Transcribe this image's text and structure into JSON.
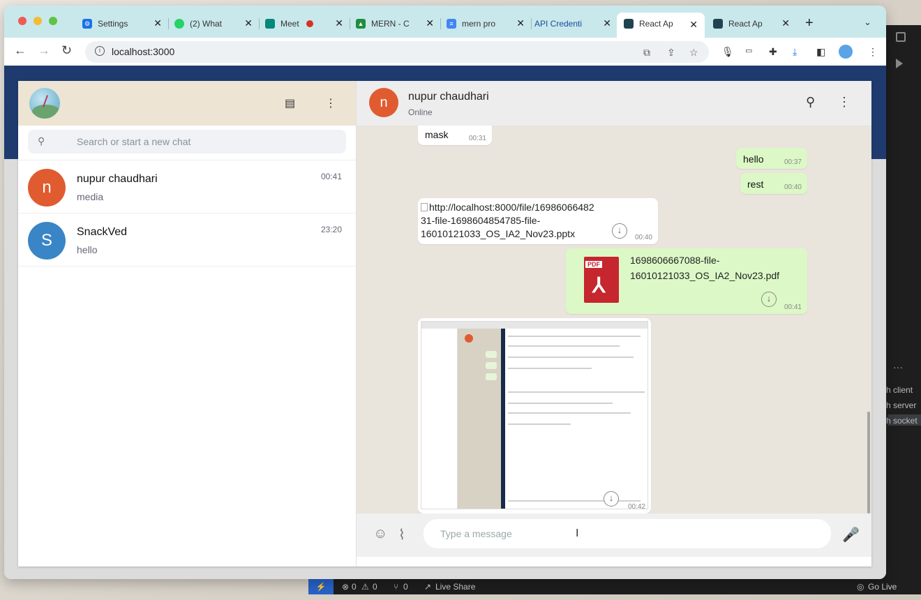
{
  "browser": {
    "tabs": [
      {
        "label": "Settings",
        "favicon": "gear-icon",
        "color": "#1a73e8"
      },
      {
        "label": "(2) What",
        "favicon": "whatsapp-icon",
        "color": "#25d366"
      },
      {
        "label": "Meet",
        "favicon": "meet-icon",
        "color": "#00897b"
      },
      {
        "label": "MERN - C",
        "favicon": "drive-icon",
        "color": "#1e8e3e"
      },
      {
        "label": "mern pro",
        "favicon": "docs-icon",
        "color": "#4285f4"
      },
      {
        "label": "API Credenti",
        "favicon": "api-icon",
        "color": "#5f86c5"
      },
      {
        "label": "React Ap",
        "favicon": "react-icon",
        "color": "#20444f"
      },
      {
        "label": "React Ap",
        "favicon": "react-icon",
        "color": "#20444f"
      }
    ],
    "active_tab_index": 6,
    "url": "localhost:3000"
  },
  "sidebar": {
    "search_placeholder": "Search or start a new chat",
    "chats": [
      {
        "initial": "n",
        "name": "nupur chaudhari",
        "preview": "media",
        "time": "00:41",
        "color": "#e05b30"
      },
      {
        "initial": "S",
        "name": "SnackVed",
        "preview": "hello",
        "time": "23:20",
        "color": "#3a85c6"
      }
    ]
  },
  "conversation": {
    "contact_initial": "n",
    "contact_name": "nupur chaudhari",
    "status": "Online",
    "messages": {
      "m1": {
        "text": "mask",
        "time": "00:31"
      },
      "m2": {
        "text": "hello",
        "time": "00:37"
      },
      "m3": {
        "text": "rest",
        "time": "00:40"
      },
      "m4": {
        "line1": "http://localhost:8000/file/16986066482",
        "line2": "31-file-1698604854785-file-",
        "line3": "16010121033_OS_IA2_Nov23.pptx",
        "time": "00:40"
      },
      "m5": {
        "line1": "1698606667088-file-",
        "line2": "16010121033_OS_IA2_Nov23.pdf",
        "time": "00:41",
        "badge": "PDF"
      },
      "m6": {
        "time": "00:42"
      }
    },
    "composer_placeholder": "Type a message"
  },
  "statusbar": {
    "errors": "0",
    "warnings": "0",
    "ports": "0",
    "live_share": "Live Share",
    "go_live": "Go Live"
  },
  "terminal": {
    "lines": [
      "h client",
      "h server",
      "h socket"
    ]
  }
}
